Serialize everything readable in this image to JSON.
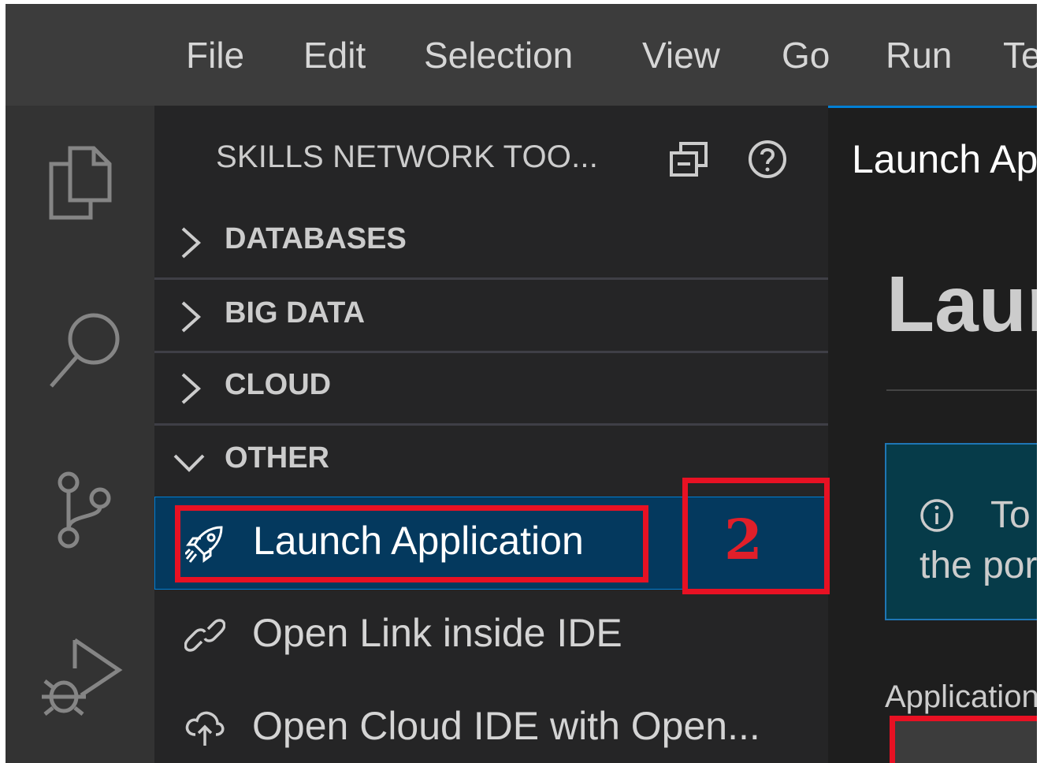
{
  "menu": {
    "items": [
      "File",
      "Edit",
      "Selection",
      "View",
      "Go",
      "Run",
      "Te"
    ]
  },
  "activity_bar": {
    "icons": [
      "explorer-icon",
      "search-icon",
      "source-control-icon",
      "run-debug-icon"
    ]
  },
  "sidebar": {
    "title": "SKILLS NETWORK TOO...",
    "sections": [
      {
        "label": "DATABASES",
        "expanded": false
      },
      {
        "label": "BIG DATA",
        "expanded": false
      },
      {
        "label": "CLOUD",
        "expanded": false
      },
      {
        "label": "OTHER",
        "expanded": true
      }
    ],
    "items": [
      {
        "label": "Launch Application",
        "icon": "rocket-icon",
        "selected": true
      },
      {
        "label": "Open Link inside IDE",
        "icon": "link-icon",
        "selected": false
      },
      {
        "label": "Open Cloud IDE with Open...",
        "icon": "cloud-upload-icon",
        "selected": false
      }
    ]
  },
  "annotation": {
    "step_number": "2",
    "color": "#e81123"
  },
  "editor": {
    "tab_title": "Launch Ap",
    "heading": "Laun",
    "info_line1": "To",
    "info_line2": "the por",
    "field_label": "Application"
  },
  "colors": {
    "accent": "#007fd4",
    "selection": "#04395e",
    "menubar": "#3c3c3c",
    "activitybar": "#333333",
    "sidebar": "#252526",
    "editor": "#1e1e1e"
  }
}
